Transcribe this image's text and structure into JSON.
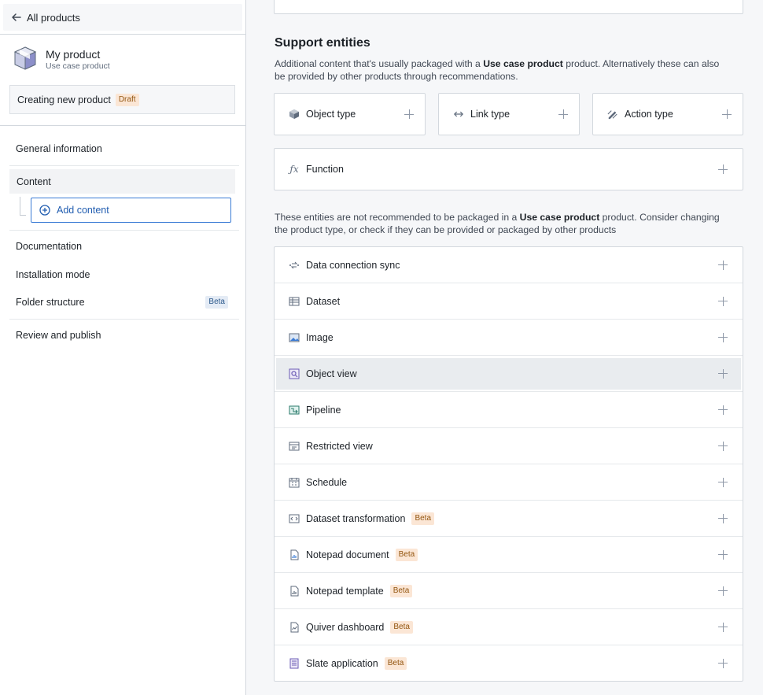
{
  "sidebar": {
    "back_label": "All products",
    "product_name": "My product",
    "product_type": "Use case product",
    "status_text": "Creating new product",
    "status_badge": "Draft",
    "nav": {
      "general": "General information",
      "content": "Content",
      "add_content": "Add content",
      "documentation": "Documentation",
      "installation": "Installation mode",
      "folder": "Folder structure",
      "folder_badge": "Beta",
      "review": "Review and publish"
    }
  },
  "main": {
    "support_title": "Support entities",
    "support_desc_1": "Additional content that's usually packaged with a ",
    "support_desc_bold": "Use case product",
    "support_desc_2": " product. Alternatively these can also be provided by other products through recommendations.",
    "types": {
      "object": "Object type",
      "link": "Link type",
      "action": "Action type",
      "function": "Function"
    },
    "not_rec_desc_1": "These entities are not recommended to be packaged in a ",
    "not_rec_desc_bold": "Use case product",
    "not_rec_desc_2": " product. Consider changing the product type, or check if they can be provided or packaged by other products",
    "entities": [
      {
        "label": "Data connection sync",
        "icon": "data-connection-icon",
        "badge": ""
      },
      {
        "label": "Dataset",
        "icon": "dataset-icon",
        "badge": ""
      },
      {
        "label": "Image",
        "icon": "image-icon",
        "badge": ""
      },
      {
        "label": "Object view",
        "icon": "object-view-icon",
        "badge": ""
      },
      {
        "label": "Pipeline",
        "icon": "pipeline-icon",
        "badge": ""
      },
      {
        "label": "Restricted view",
        "icon": "restricted-view-icon",
        "badge": ""
      },
      {
        "label": "Schedule",
        "icon": "schedule-icon",
        "badge": ""
      },
      {
        "label": "Dataset transformation",
        "icon": "transformation-icon",
        "badge": "Beta"
      },
      {
        "label": "Notepad document",
        "icon": "notepad-document-icon",
        "badge": "Beta"
      },
      {
        "label": "Notepad template",
        "icon": "notepad-template-icon",
        "badge": "Beta"
      },
      {
        "label": "Quiver dashboard",
        "icon": "quiver-icon",
        "badge": "Beta"
      },
      {
        "label": "Slate application",
        "icon": "slate-icon",
        "badge": "Beta"
      }
    ]
  },
  "colors": {
    "accent": "#215db0",
    "badge_orange_bg": "#fbe6d5",
    "badge_orange_fg": "#935610",
    "badge_blue_bg": "#e4ebf5"
  }
}
